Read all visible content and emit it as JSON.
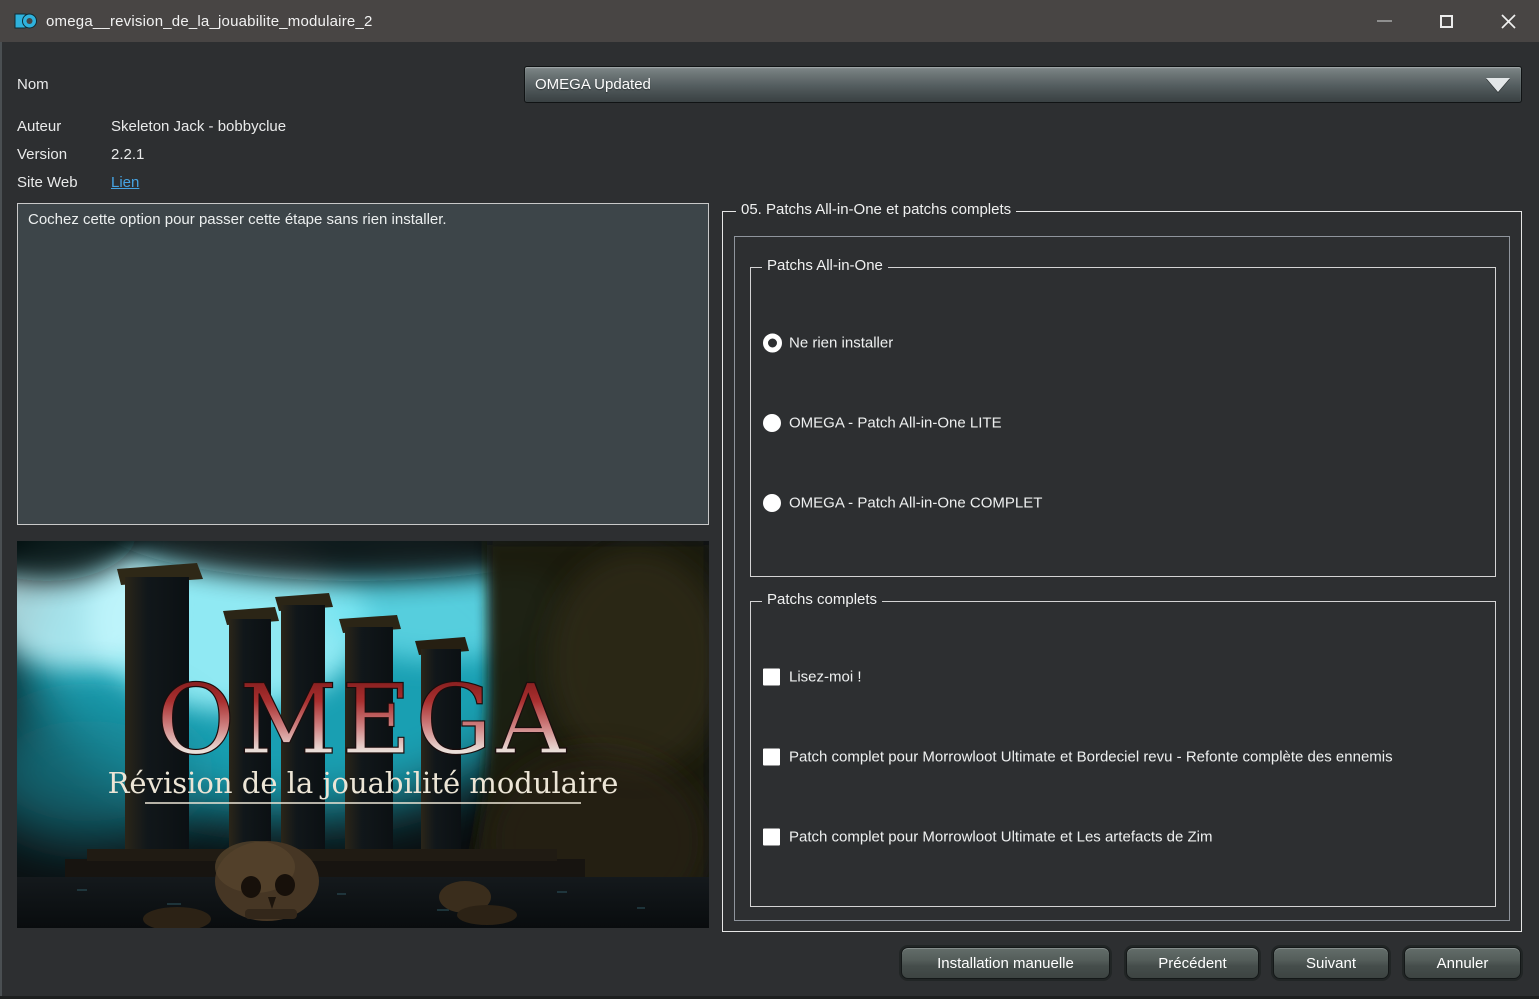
{
  "window": {
    "title": "omega__revision_de_la_jouabilite_modulaire_2"
  },
  "meta": {
    "name_label": "Nom",
    "name_value": "OMEGA Updated",
    "author_label": "Auteur",
    "author_value": "Skeleton Jack - bobbyclue",
    "version_label": "Version",
    "version_value": "2.2.1",
    "website_label": "Site Web",
    "website_link": "Lien"
  },
  "description": "Cochez cette option pour passer cette étape sans rien installer.",
  "image": {
    "title": "OMEGA",
    "subtitle": "Révision de la jouabilité modulaire"
  },
  "step": {
    "title": "05. Patchs All-in-One et patchs complets",
    "groups": [
      {
        "title": "Patchs All-in-One",
        "type": "radio",
        "options": [
          {
            "label": "Ne rien installer",
            "selected": true
          },
          {
            "label": "OMEGA - Patch All-in-One LITE",
            "selected": false
          },
          {
            "label": "OMEGA - Patch All-in-One COMPLET",
            "selected": false
          }
        ]
      },
      {
        "title": "Patchs complets",
        "type": "checkbox",
        "options": [
          {
            "label": "Lisez-moi !",
            "checked": false
          },
          {
            "label": "Patch complet pour Morrowloot Ultimate et Bordeciel revu - Refonte complète des ennemis",
            "checked": false
          },
          {
            "label": "Patch complet pour Morrowloot Ultimate et Les artefacts de Zim",
            "checked": false
          }
        ]
      }
    ]
  },
  "buttons": {
    "manual": "Installation manuelle",
    "previous": "Précédent",
    "next": "Suivant",
    "cancel": "Annuler"
  },
  "colors": {
    "link_blue": "#46a3e2",
    "logo_cyan": "#2fb2dd",
    "background": "#2d2f31",
    "titlebar": "#484544",
    "description_bg": "#3d4549"
  }
}
